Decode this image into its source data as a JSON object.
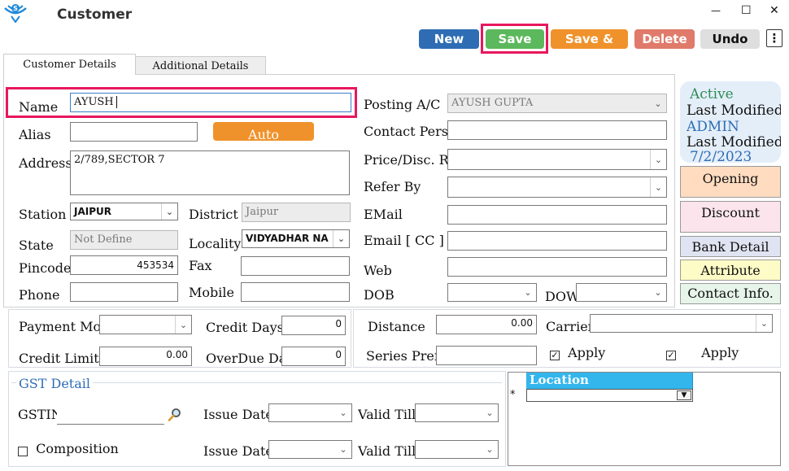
{
  "window": {
    "title": "Customer",
    "minimize": "—",
    "maximize": "☐",
    "close": "✕"
  },
  "toolbar": {
    "new": "New",
    "save": "Save",
    "save_and": "Save &",
    "delete": "Delete",
    "undo": "Undo",
    "more": "⋮"
  },
  "tabs": [
    "Customer Details",
    "Additional Details"
  ],
  "form": {
    "name": {
      "label": "Name",
      "value": "AYUSH"
    },
    "alias": {
      "label": "Alias",
      "value": ""
    },
    "auto_button": "Auto",
    "address": {
      "label": "Address",
      "value": "2/789,SECTOR 7"
    },
    "station": {
      "label": "Station",
      "value": "JAIPUR"
    },
    "district": {
      "label": "District",
      "value": "Jaipur"
    },
    "state": {
      "label": "State",
      "value": "Not Define"
    },
    "locality": {
      "label": "Locality",
      "value": "VIDYADHAR NA"
    },
    "pincode": {
      "label": "Pincode",
      "value": "453534"
    },
    "fax": {
      "label": "Fax",
      "value": ""
    },
    "phone": {
      "label": "Phone",
      "value": ""
    },
    "mobile": {
      "label": "Mobile",
      "value": ""
    },
    "posting_ac": {
      "label": "Posting A/C",
      "value": "AYUSH GUPTA"
    },
    "contact_person": {
      "label": "Contact Person",
      "value": ""
    },
    "price_disc_ref": {
      "label": "Price/Disc. Ref.",
      "value": ""
    },
    "refer_by": {
      "label": "Refer By",
      "value": ""
    },
    "email": {
      "label": "EMail",
      "value": ""
    },
    "email_cc": {
      "label": "Email [ CC ]",
      "value": ""
    },
    "web": {
      "label": "Web",
      "value": ""
    },
    "dob": {
      "label": "DOB",
      "value": ""
    },
    "dow": {
      "label": "DOW",
      "value": ""
    }
  },
  "status": {
    "active": "Active",
    "last_modified_by_label": "Last Modified By",
    "last_modified_by": "ADMIN",
    "last_modified_on_label": "Last Modified On",
    "last_modified_on": "7/2/2023"
  },
  "side_buttons": [
    "Opening",
    "Discount",
    "Bank Detail",
    "Attribute",
    "Contact Info."
  ],
  "credit": {
    "payment_mode": {
      "label": "Payment Mode",
      "value": ""
    },
    "credit_days": {
      "label": "Credit Days",
      "value": "0"
    },
    "credit_limit": {
      "label": "Credit Limit",
      "value": "0.00"
    },
    "overdue_days": {
      "label": "OverDue Days",
      "value": "0"
    }
  },
  "shipping": {
    "distance": {
      "label": "Distance",
      "value": "0.00"
    },
    "carrier": {
      "label": "Carrier",
      "value": ""
    },
    "series_prefix": {
      "label": "Series Prefix",
      "value": ""
    },
    "apply_1": "Apply",
    "apply_2": "Apply"
  },
  "gst": {
    "title": "GST Detail",
    "gstin": {
      "label": "GSTIN",
      "value": ""
    },
    "issue_date_1": {
      "label": "Issue Date",
      "value": ""
    },
    "valid_till_1": {
      "label": "Valid Till",
      "value": ""
    },
    "composition": "Composition",
    "issue_date_2": {
      "label": "Issue Date",
      "value": ""
    },
    "valid_till_2": {
      "label": "Valid Till",
      "value": ""
    }
  },
  "location": {
    "header": "Location",
    "new_row_marker": "*"
  },
  "colors": {
    "new": "#2e6db4",
    "save": "#5cb85c",
    "save_and": "#f0922b",
    "delete": "#e07a6a",
    "undo": "#dedede",
    "highlight": "#e8175d",
    "opening": "#ffdcc0",
    "discount": "#fbe4ec",
    "bank_detail": "#e0e4f2",
    "attribute": "#fdfbc6",
    "contact_info": "#e6f4ea",
    "status_bg": "#e4eef9",
    "location_header": "#33b6ec"
  }
}
